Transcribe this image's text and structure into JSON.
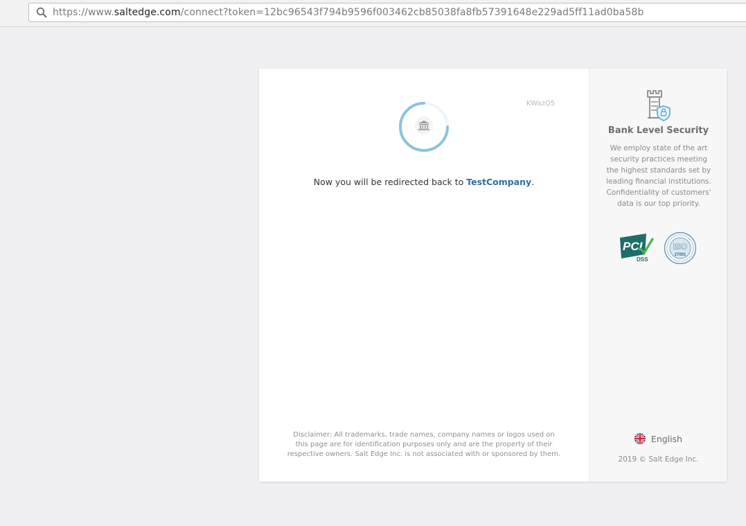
{
  "browser": {
    "url_prefix": "https://www.",
    "url_domain": "saltedge.com",
    "url_path": "/connect?token=12bc96543f794b9596f003462cb85038fa8fb57391648e229ad5ff11ad0ba58b"
  },
  "main": {
    "session_code": "KWazQ5",
    "redirect_text": "Now you will be redirected back to ",
    "company_name": "TestCompany",
    "redirect_suffix": ".",
    "disclaimer": "Disclaimer: All trademarks, trade names, company names or logos used on this page are for identification purposes only and are the property of their respective owners. Salt Edge Inc. is not associated with or sponsored by them."
  },
  "side": {
    "security_title": "Bank Level Security",
    "security_text": "We employ state of the art security practices meeting the highest standards set by leading financial institutions. Confidentiality of customers' data is our top priority.",
    "pci_text": "PCI",
    "pci_sub": "DSS",
    "iso_text": "ISO",
    "iso_sub": "27001",
    "language": "English",
    "copyright": "2019 © Salt Edge Inc."
  },
  "icons": [
    "search-icon",
    "bank-icon",
    "tower-lock-icon",
    "pci-dss-logo",
    "iso-27001-logo",
    "uk-flag-icon"
  ],
  "colors": {
    "accent": "#2f6e99",
    "spinner": "#8cc4d8",
    "panel_bg": "#f7f7f8",
    "page_bg": "#f0f0f2"
  }
}
